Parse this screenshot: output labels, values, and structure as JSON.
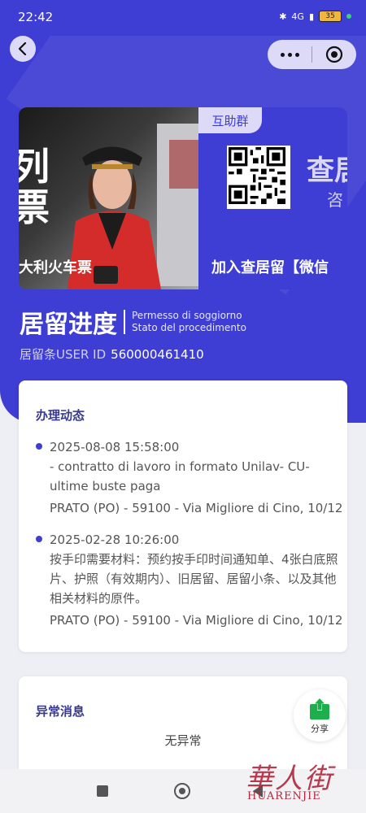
{
  "status": {
    "time": "22:42",
    "network": "4G",
    "battery": "35"
  },
  "colors": {
    "brand": "#3e3dd4",
    "card_title": "#3a3a8c",
    "accent_soft": "#dcdaf6"
  },
  "banner": {
    "slide1_caption": "大利火车票",
    "slide1_bigtext": "列\n票",
    "slide2_tag": "互助群",
    "slide2_caption": "加入查居留【微信",
    "slide2_bigtext": "查居",
    "slide2_smalltext": "咨"
  },
  "heading": {
    "title": "居留进度",
    "sub_line1": "Permesso di soggiorno",
    "sub_line2": "Stato del procedimento"
  },
  "user": {
    "label": "居留条USER ID",
    "value": "560000461410"
  },
  "progress": {
    "title": "办理动态",
    "items": [
      {
        "date": "2025-08-08 15:58:00",
        "text": "- contratto di lavoro in formato Unilav- CU- ultime buste paga",
        "location": "PRATO (PO) - 59100 - Via Migliore di Cino, 10/12"
      },
      {
        "date": "2025-02-28 10:26:00",
        "text": "按手印需要材料：预约按手印时间通知单、4张白底照片、护照（有效期内）、旧居留、居留小条、以及其他相关材料的原件。",
        "location": "PRATO (PO) - 59100 - Via Migliore di Cino, 10/12"
      }
    ]
  },
  "anomaly": {
    "title": "异常消息",
    "empty": "无异常"
  },
  "share": {
    "label": "分享"
  },
  "watermark": {
    "cn": "華人街",
    "en": "HUARENJIE"
  }
}
